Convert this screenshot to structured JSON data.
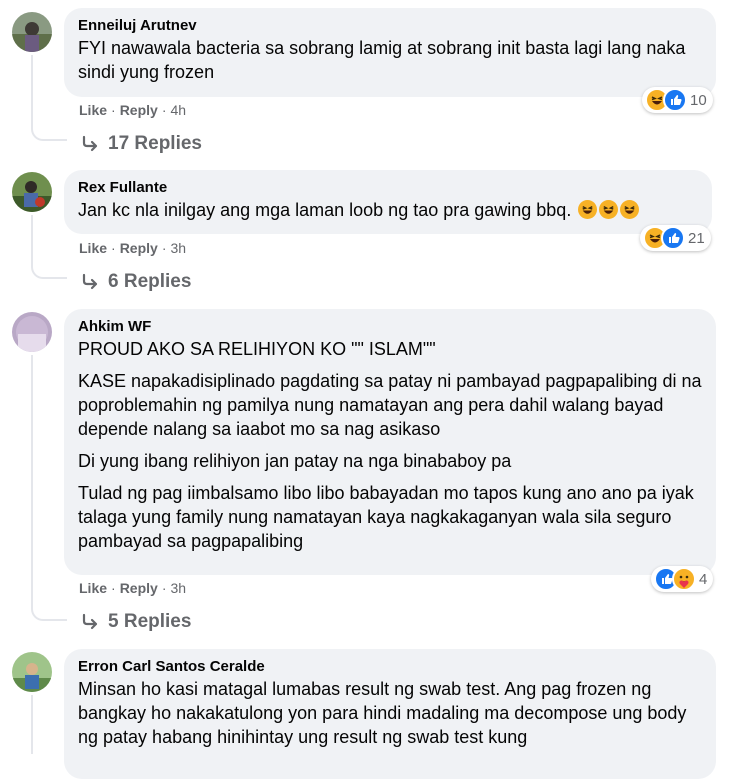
{
  "comments": [
    {
      "author": "Enneiluj Arutnev",
      "paragraphs": [
        "FYI nawawala bacteria sa sobrang lamig at sobrang init basta lagi lang naka sindi yung frozen"
      ],
      "like": "Like",
      "reply": "Reply",
      "time": "4h",
      "reactions": [
        "haha",
        "like"
      ],
      "reaction_count": "10",
      "replies_label": "17 Replies"
    },
    {
      "author": "Rex Fullante",
      "paragraphs": [
        "Jan kc nla inilgay ang mga laman loob ng tao pra gawing bbq."
      ],
      "emoji_tail": [
        "haha-emoji",
        "haha-emoji",
        "haha-emoji"
      ],
      "like": "Like",
      "reply": "Reply",
      "time": "3h",
      "reactions": [
        "haha",
        "like"
      ],
      "reaction_count": "21",
      "replies_label": "6 Replies"
    },
    {
      "author": "Ahkim WF",
      "paragraphs": [
        "PROUD AKO SA RELIHIYON KO \"\" ISLAM\"\"",
        "KASE napakadisiplinado pagdating sa patay ni pambayad pagpapalibing di na poproblemahin ng pamilya nung namatayan ang pera dahil walang bayad depende nalang sa iaabot mo sa nag asikaso",
        "Di yung ibang relihiyon jan patay na nga binababoy pa",
        "Tulad ng pag iimbalsamo libo libo babayadan mo tapos kung ano ano pa iyak talaga yung family nung namatayan kaya nagkakaganyan wala sila seguro pambayad sa pagpapalibing"
      ],
      "like": "Like",
      "reply": "Reply",
      "time": "3h",
      "reactions": [
        "like",
        "care"
      ],
      "reaction_count": "4",
      "replies_label": "5 Replies"
    },
    {
      "author": "Erron Carl Santos Ceralde",
      "paragraphs": [
        "Minsan ho kasi matagal lumabas result ng swab test. Ang pag frozen ng bangkay ho nakakatulong yon para hindi madaling ma decompose ung body ng patay habang hinihintay ung result ng swab test kung"
      ]
    }
  ],
  "colors": {
    "bubble": "#f0f2f5",
    "meta_text": "#65676b",
    "like_blue": "#1877f2",
    "haha_yellow": "#f7b125",
    "thread_line": "#e4e6eb"
  }
}
